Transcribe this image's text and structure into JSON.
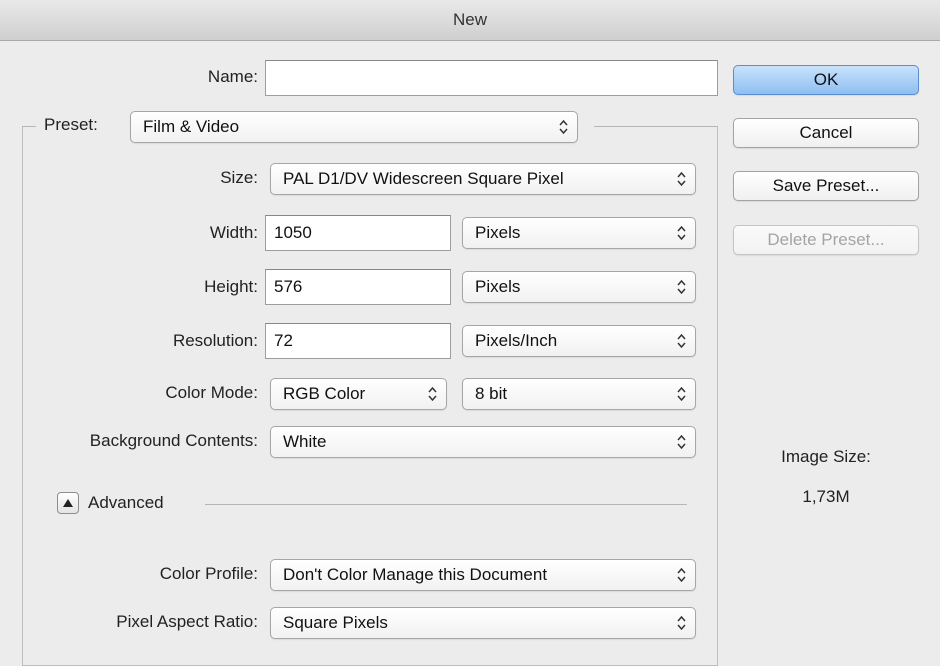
{
  "window": {
    "title": "New"
  },
  "form": {
    "name_label": "Name:",
    "name_value": "",
    "preset_label": "Preset:",
    "preset_value": "Film & Video",
    "size_label": "Size:",
    "size_value": "PAL D1/DV Widescreen Square Pixel",
    "width_label": "Width:",
    "width_value": "1050",
    "width_unit": "Pixels",
    "height_label": "Height:",
    "height_value": "576",
    "height_unit": "Pixels",
    "resolution_label": "Resolution:",
    "resolution_value": "72",
    "resolution_unit": "Pixels/Inch",
    "color_mode_label": "Color Mode:",
    "color_mode_value": "RGB Color",
    "bit_depth_value": "8 bit",
    "background_label": "Background Contents:",
    "background_value": "White"
  },
  "advanced": {
    "label": "Advanced",
    "expanded": true,
    "color_profile_label": "Color Profile:",
    "color_profile_value": "Don't Color Manage this Document",
    "pixel_aspect_label": "Pixel Aspect Ratio:",
    "pixel_aspect_value": "Square Pixels"
  },
  "buttons": {
    "ok": "OK",
    "cancel": "Cancel",
    "save_preset": "Save Preset...",
    "delete_preset": "Delete Preset..."
  },
  "info": {
    "image_size_label": "Image Size:",
    "image_size_value": "1,73M"
  },
  "icons": {
    "select_arrows": "up-down-chevron-icon",
    "disclosure": "triangle-up-icon"
  },
  "colors": {
    "default_button": "#8ebff2",
    "window_background": "#ececec"
  }
}
